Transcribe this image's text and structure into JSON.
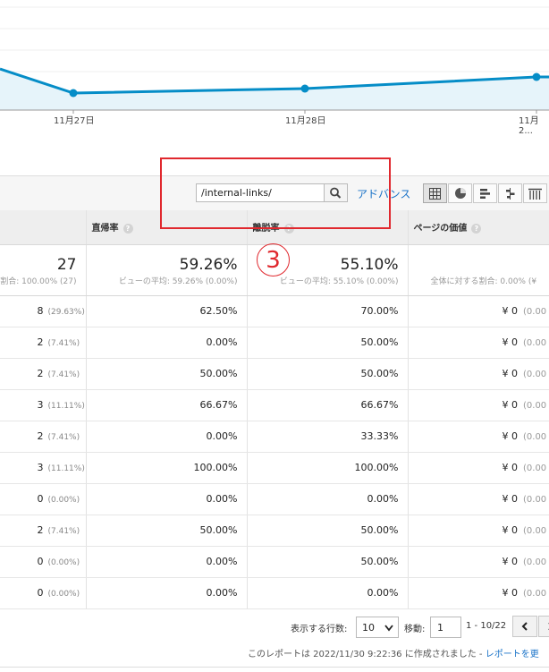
{
  "chart": {
    "x_labels": [
      "11月27日",
      "11月28日",
      "11月2..."
    ],
    "line_color": "#058dc7",
    "fill_color": "#e6f4fa"
  },
  "toolbar": {
    "search_value": "/internal-links/",
    "advanced_label": "アドバンス",
    "view_buttons": [
      "grid-view-icon",
      "pie-view-icon",
      "bar-view-icon",
      "comparison-view-icon",
      "pivot-view-icon"
    ]
  },
  "table": {
    "headers": {
      "c2": "直帰率",
      "c3": "離脱率",
      "c4": "ページの価値"
    },
    "totals": {
      "c1_value": "27",
      "c1_sub": "割合: 100.00% (27)",
      "c2_value": "59.26%",
      "c2_sub": "ビューの平均: 59.26% (0.00%)",
      "c3_value": "55.10%",
      "c3_sub": "ビューの平均: 55.10% (0.00%)",
      "c4_value": "¥",
      "c4_sub": "全体に対する割合: 0.00% (¥"
    },
    "rows": [
      {
        "c1": "8",
        "c1p": "(29.63%)",
        "c2": "62.50%",
        "c3": "70.00%",
        "c4": "¥ 0",
        "c4p": "(0.00"
      },
      {
        "c1": "2",
        "c1p": "(7.41%)",
        "c2": "0.00%",
        "c3": "50.00%",
        "c4": "¥ 0",
        "c4p": "(0.00"
      },
      {
        "c1": "2",
        "c1p": "(7.41%)",
        "c2": "50.00%",
        "c3": "50.00%",
        "c4": "¥ 0",
        "c4p": "(0.00"
      },
      {
        "c1": "3",
        "c1p": "(11.11%)",
        "c2": "66.67%",
        "c3": "66.67%",
        "c4": "¥ 0",
        "c4p": "(0.00"
      },
      {
        "c1": "2",
        "c1p": "(7.41%)",
        "c2": "0.00%",
        "c3": "33.33%",
        "c4": "¥ 0",
        "c4p": "(0.00"
      },
      {
        "c1": "3",
        "c1p": "(11.11%)",
        "c2": "100.00%",
        "c3": "100.00%",
        "c4": "¥ 0",
        "c4p": "(0.00"
      },
      {
        "c1": "0",
        "c1p": "(0.00%)",
        "c2": "0.00%",
        "c3": "0.00%",
        "c4": "¥ 0",
        "c4p": "(0.00"
      },
      {
        "c1": "2",
        "c1p": "(7.41%)",
        "c2": "50.00%",
        "c3": "50.00%",
        "c4": "¥ 0",
        "c4p": "(0.00"
      },
      {
        "c1": "0",
        "c1p": "(0.00%)",
        "c2": "0.00%",
        "c3": "50.00%",
        "c4": "¥ 0",
        "c4p": "(0.00"
      },
      {
        "c1": "0",
        "c1p": "(0.00%)",
        "c2": "0.00%",
        "c3": "0.00%",
        "c4": "¥ 0",
        "c4p": "(0.00"
      }
    ]
  },
  "pagination": {
    "rows_label": "表示する行数:",
    "rows_value": "10",
    "goto_label": "移動:",
    "goto_value": "1",
    "range": "1 - 10/22"
  },
  "footer": {
    "text": "このレポートは 2022/11/30 9:22:36 に作成されました - ",
    "link": "レポートを更"
  },
  "annotation": {
    "number": "3",
    "color": "#e0282e"
  }
}
